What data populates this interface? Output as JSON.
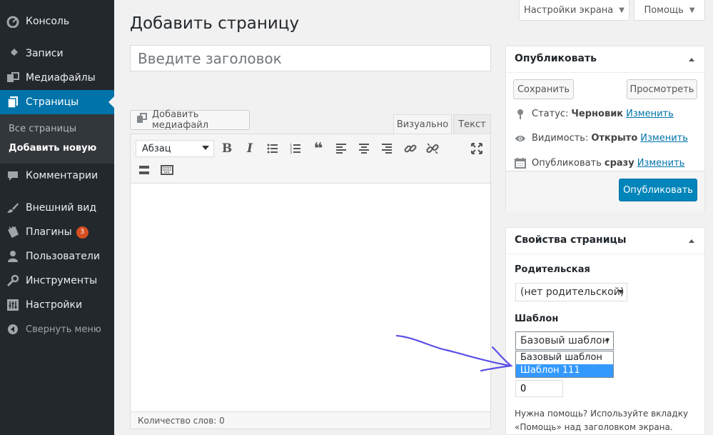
{
  "sidebar": {
    "items": [
      {
        "label": "Консоль",
        "icon": "dashboard-icon"
      },
      {
        "label": "Записи",
        "icon": "pin-icon"
      },
      {
        "label": "Медиафайлы",
        "icon": "media-icon"
      },
      {
        "label": "Страницы",
        "icon": "pages-icon"
      },
      {
        "label": "Комментарии",
        "icon": "comments-icon"
      },
      {
        "label": "Внешний вид",
        "icon": "brush-icon"
      },
      {
        "label": "Плагины",
        "icon": "plugins-icon",
        "badge": "3"
      },
      {
        "label": "Пользователи",
        "icon": "users-icon"
      },
      {
        "label": "Инструменты",
        "icon": "tools-icon"
      },
      {
        "label": "Настройки",
        "icon": "settings-icon"
      }
    ],
    "submenu": [
      "Все страницы",
      "Добавить новую"
    ],
    "collapse_label": "Свернуть меню"
  },
  "top": {
    "screen_options": "Настройки экрана",
    "help": "Помощь"
  },
  "page_title": "Добавить страницу",
  "title_placeholder": "Введите заголовок",
  "editor": {
    "add_media": "Добавить медиафайл",
    "tabs": {
      "visual": "Визуально",
      "text": "Текст"
    },
    "format": "Абзац",
    "word_count": "Количество слов: 0"
  },
  "publish": {
    "title": "Опубликовать",
    "save": "Сохранить",
    "preview": "Просмотреть",
    "status_label": "Статус:",
    "status_value": "Черновик",
    "visibility_label": "Видимость:",
    "visibility_value": "Открыто",
    "schedule_label": "Опубликовать",
    "schedule_value": "сразу",
    "edit": "Изменить",
    "publish_btn": "Опубликовать"
  },
  "attributes": {
    "title": "Свойства страницы",
    "parent_label": "Родительская",
    "parent_value": "(нет родительской)",
    "template_label": "Шаблон",
    "template_value": "Базовый шаблон",
    "template_options": [
      "Базовый шаблон",
      "Шаблон 111"
    ],
    "order_value": "0",
    "help": "Нужна помощь? Используйте вкладку «Помощь» над заголовком экрана."
  },
  "colors": {
    "accent": "#0073aa",
    "sidebar": "#23282d",
    "publish_button": "#0085ba",
    "annotation": "#5b50e6"
  }
}
